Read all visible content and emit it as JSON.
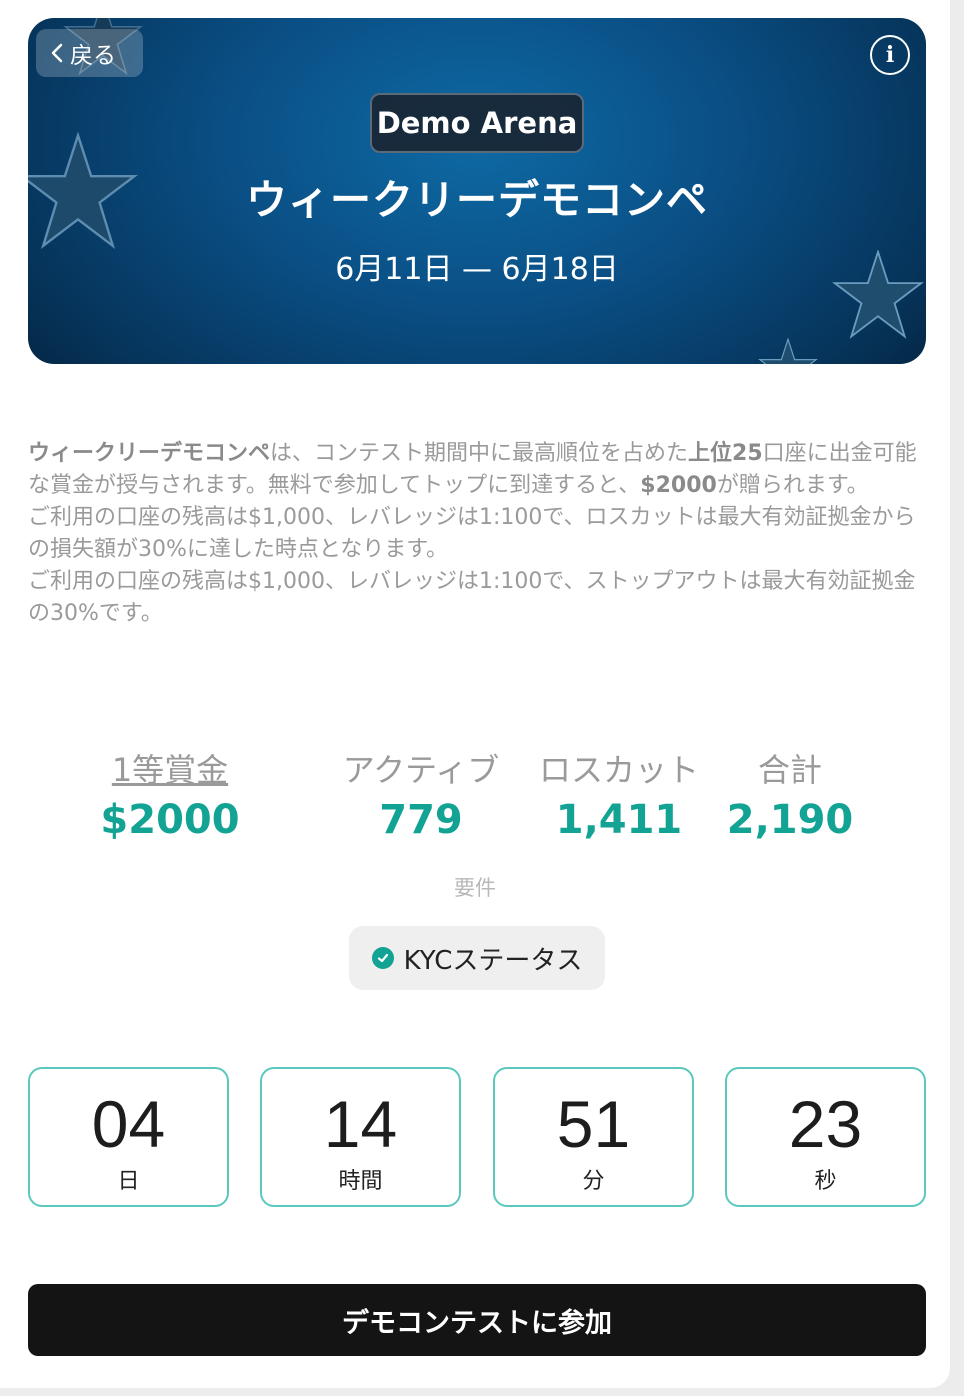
{
  "banner": {
    "back_label": "戻る",
    "badge": "Demo Arena",
    "title": "ウィークリーデモコンペ",
    "dates": "6月11日 — 6月18日"
  },
  "description": {
    "p1_title": "ウィークリーデモコンペ",
    "p1_text_a": "は、コンテスト期間中に最高順位を占めた",
    "p1_bold_rank": "上位25",
    "p1_text_b": "口座に出金可能な賞金が授与されます。無料で参加してトップに到達すると、",
    "p1_bold_prize": "$2000",
    "p1_text_c": "が贈られます。",
    "p2": "ご利用の口座の残高は$1,000、レバレッジは1:100で、ロスカットは最大有効証拠金からの損失額が30%に達した時点となります。",
    "p3": "ご利用の口座の残高は$1,000、レバレッジは1:100で、ストップアウトは最大有効証拠金の30%です。"
  },
  "stats": [
    {
      "label": "1等賞金",
      "value": "$2000"
    },
    {
      "label": "アクティブ",
      "value": "779"
    },
    {
      "label": "ロスカット",
      "value": "1,411"
    },
    {
      "label": "合計",
      "value": "2,190"
    }
  ],
  "requirements": {
    "label": "要件",
    "kyc": "KYCステータス"
  },
  "countdown": [
    {
      "value": "04",
      "unit": "日"
    },
    {
      "value": "14",
      "unit": "時間"
    },
    {
      "value": "51",
      "unit": "分"
    },
    {
      "value": "23",
      "unit": "秒"
    }
  ],
  "join_label": "デモコンテストに参加",
  "colors": {
    "accent": "#12a394",
    "countdown_border": "#5cc8bd",
    "button_bg": "#141414",
    "banner_blue": "#0a4f85"
  }
}
